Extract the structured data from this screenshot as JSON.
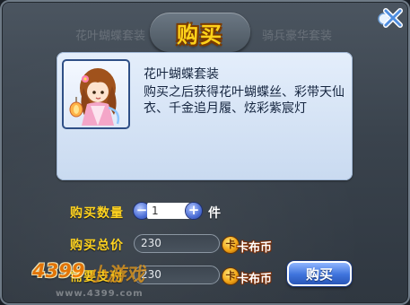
{
  "dialog": {
    "title": "购买",
    "close_icon": "close-x-icon",
    "background_text_left": "花叶蝴蝶套装",
    "background_text_right": "骑兵豪华套装"
  },
  "item": {
    "name": "花叶蝴蝶套装",
    "description": "购买之后获得花叶蝴蝶丝、彩带天仙衣、千金追月履、炫彩紫宸灯",
    "image_icon": "character-portrait-icon"
  },
  "quantity": {
    "label": "购买数量",
    "value": "1",
    "unit": "件",
    "decrement_icon": "minus-icon",
    "increment_icon": "plus-icon"
  },
  "total": {
    "label": "购买总价",
    "value": "230",
    "currency": "卡布币",
    "currency_icon_text": "卡"
  },
  "payment": {
    "label": "需要支付",
    "value": "230",
    "currency": "卡布币",
    "currency_icon_text": "卡"
  },
  "buy_button": {
    "label": "购买"
  },
  "watermark": {
    "logo": "4399",
    "logo_suffix": "小游戏",
    "url": "www.4399.com"
  },
  "colors": {
    "label_gold": "#ffd320",
    "panel_blue": "#d6e3f5",
    "button_blue": "#3e73dc"
  }
}
